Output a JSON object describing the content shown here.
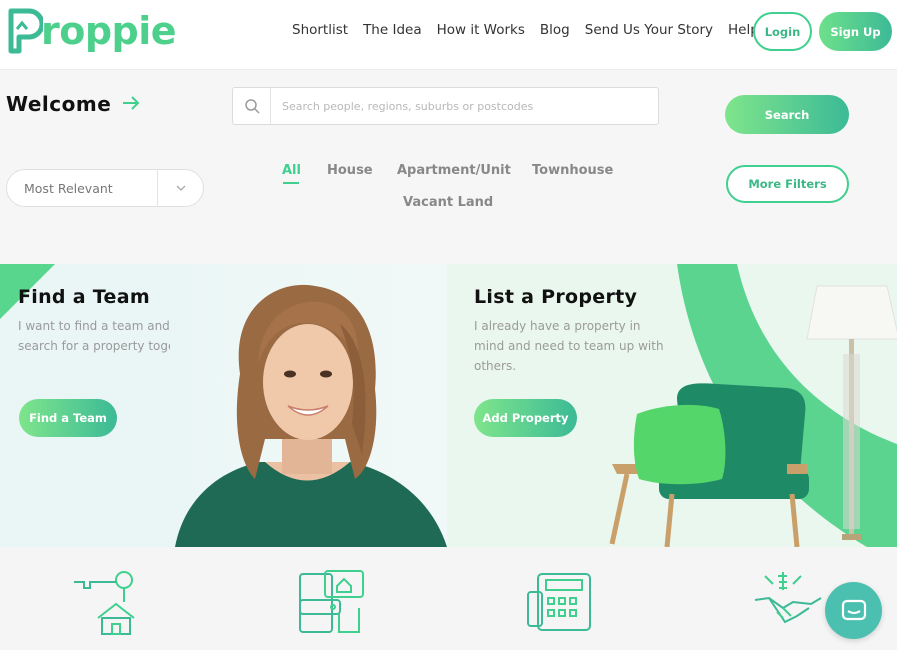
{
  "brand": {
    "name": "roppie",
    "accent": "#4dd08b",
    "accent_dark": "#3cba96"
  },
  "nav": {
    "items": [
      "Shortlist",
      "The Idea",
      "How it Works",
      "Blog",
      "Send Us Your Story",
      "Help"
    ],
    "login_label": "Login",
    "signup_label": "Sign Up"
  },
  "search": {
    "welcome": "Welcome",
    "placeholder": "Search people, regions, suburbs or postcodes",
    "button_label": "Search",
    "more_filters_label": "More Filters",
    "sort_value": "Most Relevant",
    "types": [
      "All",
      "House",
      "Apartment/Unit",
      "Townhouse",
      "Vacant Land"
    ],
    "active_type": "All"
  },
  "cards": {
    "team": {
      "title": "Find a Team",
      "description": "I want to find a team and then search for a property together.",
      "button_label": "Find a Team"
    },
    "property": {
      "title": "List a Property",
      "description": "I already have a property in mind and need to team up with others.",
      "button_label": "Add Property"
    }
  },
  "features": [
    {
      "icon": "house-key-icon"
    },
    {
      "icon": "wallet-house-icon"
    },
    {
      "icon": "calculator-icon"
    },
    {
      "icon": "handshake-money-icon"
    }
  ]
}
